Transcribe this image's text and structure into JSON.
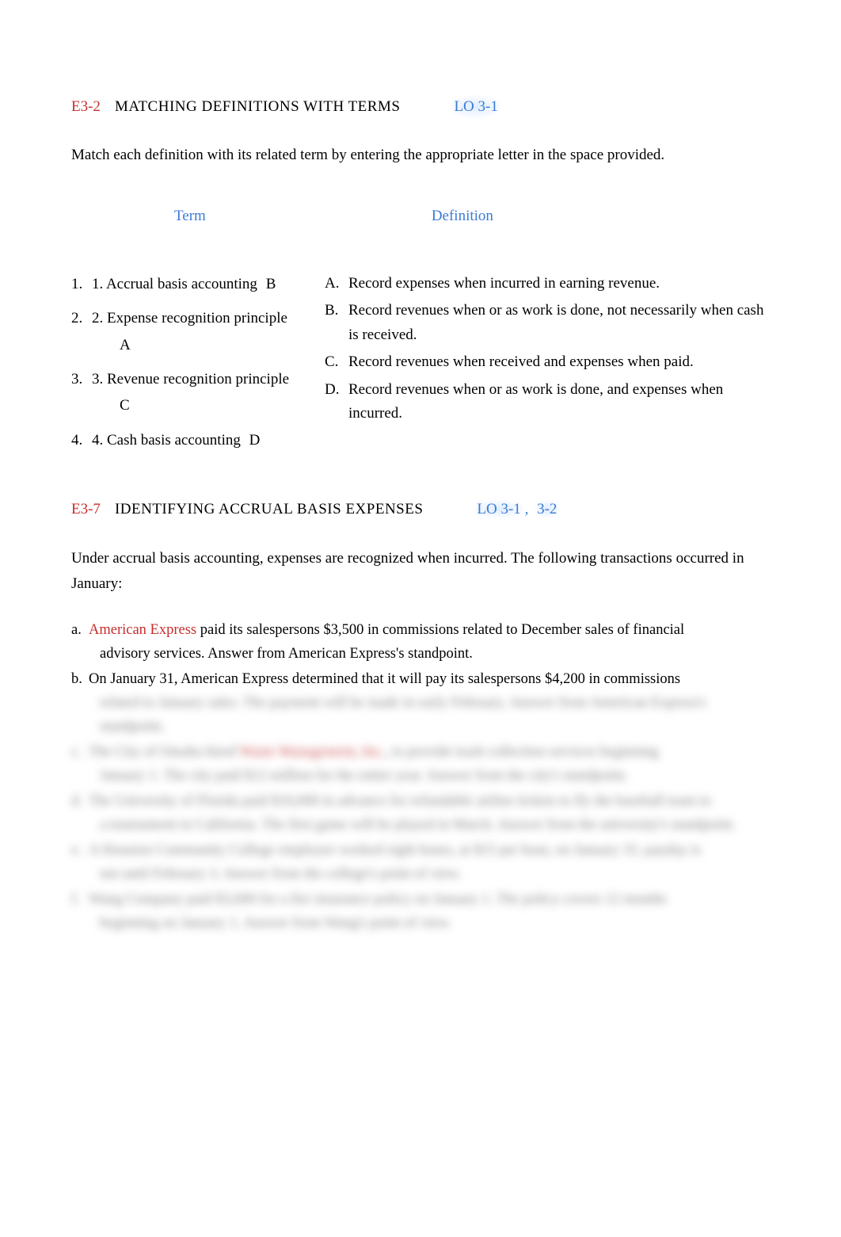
{
  "exercise1": {
    "code": "E3-2",
    "title": "MATCHING DEFINITIONS WITH TERMS",
    "lo": "LO 3-1",
    "instruction": "Match each definition with its related term by entering the appropriate letter in the space provided.",
    "term_header": "Term",
    "def_header": "Definition",
    "terms": [
      {
        "outer": "1.",
        "label": "1. Accrual basis accounting",
        "answer": "B"
      },
      {
        "outer": "2.",
        "label": "2. Expense recognition principle",
        "answer": "A"
      },
      {
        "outer": "3.",
        "label": "3. Revenue recognition principle",
        "answer": "C"
      },
      {
        "outer": "4.",
        "label": "4. Cash basis accounting",
        "answer": "D"
      }
    ],
    "definitions": [
      {
        "letter": "A.",
        "text": "Record expenses when incurred in earning revenue."
      },
      {
        "letter": "B.",
        "text": "Record revenues when or as work is done, not necessarily when cash is received."
      },
      {
        "letter": "C.",
        "text": "Record revenues when received and expenses when paid."
      },
      {
        "letter": "D.",
        "text": "Record revenues when or as work is done, and expenses when incurred."
      }
    ]
  },
  "exercise2": {
    "code": "E3-7",
    "title": "IDENTIFYING ACCRUAL BASIS EXPENSES",
    "lo1": "LO 3-1",
    "lo_sep": ",",
    "lo2": "3-2",
    "instruction": "Under accrual basis accounting, expenses are recognized when incurred. The following transactions occurred in January:",
    "items": [
      {
        "letter": "a.",
        "company": "American Express",
        "line1_after": "  paid its salespersons $3,500 in commissions related to December sales of financial",
        "cont": "advisory services. Answer from American Express's standpoint."
      },
      {
        "letter": "b.",
        "line1": "On January 31, American Express determined that it will pay its salespersons $4,200 in commissions",
        "cont_blur": "related to January sales. The payment will be made in early February. Answer from American Express's standpoint."
      },
      {
        "letter_blur": "c.",
        "line1_blur_a": "The City of Omaha hired ",
        "company_blur": "Waste Management, Inc.",
        "line1_blur_b": ", to provide trash collection services beginning",
        "cont_blur": "January 1. The city paid $12 million for the entire year. Answer from the city's standpoint."
      },
      {
        "letter_blur": "d.",
        "line1_blur": "The University of Florida paid $10,000 in advance for refundable airline tickets to fly the baseball team to",
        "cont_blur": "a tournament in California. The first game will be played in March. Answer from the university's standpoint."
      },
      {
        "letter_blur": "e.",
        "line1_blur": "A Houston Community College employee worked eight hours, at $15 per hour, on January 31; payday is",
        "cont_blur": "not until February 3. Answer from the college's point of view."
      },
      {
        "letter_blur": "f.",
        "line1_blur": "Wang Company paid $3,600 for a fire insurance policy on January 1. The policy covers 12 months",
        "cont_blur": "beginning on January 1. Answer from Wang's point of view."
      }
    ]
  }
}
